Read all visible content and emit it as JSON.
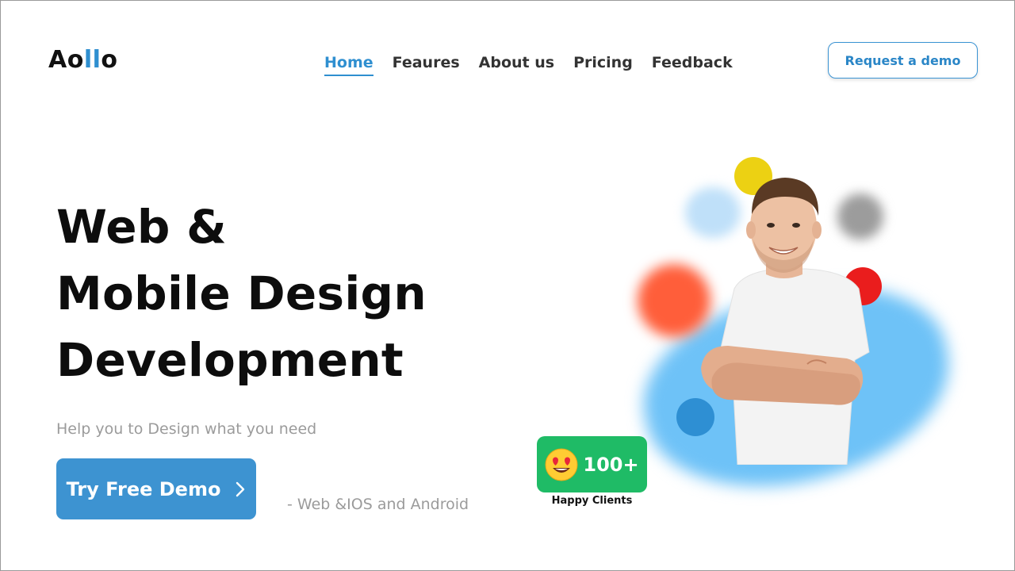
{
  "brand": {
    "logo_prefix": "Ao",
    "logo_accent": "ll",
    "logo_suffix": "o"
  },
  "nav": {
    "items": [
      {
        "label": "Home",
        "active": true
      },
      {
        "label": "Feaures",
        "active": false
      },
      {
        "label": "About us",
        "active": false
      },
      {
        "label": "Pricing",
        "active": false
      },
      {
        "label": "Feedback",
        "active": false
      }
    ]
  },
  "header": {
    "demo_button_label": "Request a demo"
  },
  "hero": {
    "title_lines": [
      "Web &",
      "Mobile Design",
      "Development"
    ],
    "subtitle": "Help you to Design what you need",
    "cta_label": "Try Free Demo",
    "cta_icon": "chevron-right-icon",
    "platform_note": "- Web &IOS and Android"
  },
  "badge": {
    "emoji_icon": "heart-eyes-emoji-icon",
    "count": "100+",
    "caption": "Happy Clients"
  },
  "colors": {
    "accent": "#2f8fd0",
    "cta_bg": "#3d93d1",
    "badge_bg": "#1fbb66",
    "muted_text": "#9b9b9b",
    "yellow": "#ecd113",
    "red": "#ea1d1d",
    "orange": "#ff5e3a",
    "light_blue": "#6ec2f7"
  }
}
